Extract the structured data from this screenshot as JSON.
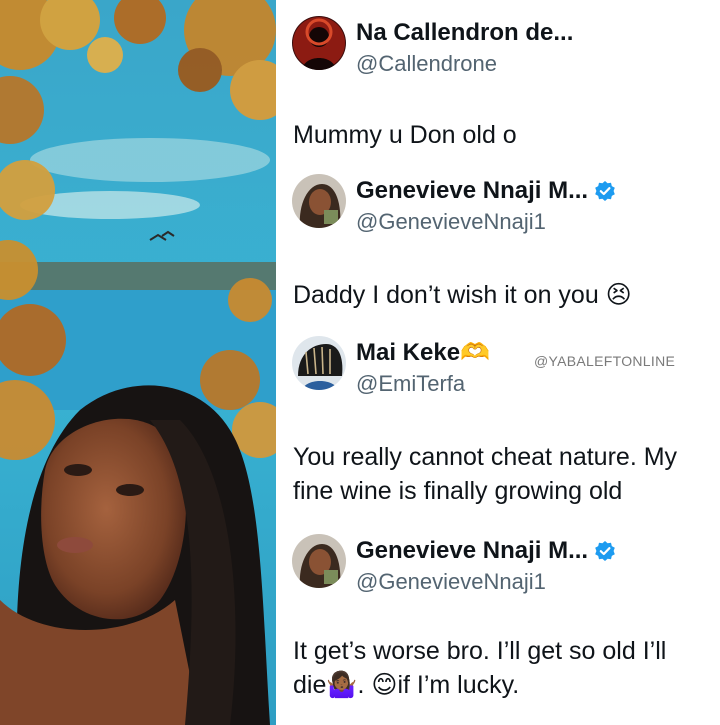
{
  "tweets": [
    {
      "display_name": "Na Callendron de...",
      "handle": "@Callendrone",
      "text": "Mummy u Don old o",
      "verified": false,
      "avatar_icon": "person-silhouette-red-avatar"
    },
    {
      "display_name": "Genevieve Nnaji M...",
      "handle": "@GenevieveNnaji1",
      "text": "Daddy I don’t wish it on you 😣",
      "verified": true,
      "avatar_icon": "woman-photo-avatar"
    },
    {
      "display_name": "Mai Keke🫶",
      "handle": "@EmiTerfa",
      "text": "You really cannot cheat nature. My fine wine is finally growing old",
      "verified": false,
      "avatar_icon": "braided-hair-avatar"
    },
    {
      "display_name": "Genevieve Nnaji M...",
      "handle": "@GenevieveNnaji1",
      "text": "It get’s worse bro. I’ll get so old I’ll die🤷🏾‍♀️. 😊if I’m lucky.",
      "verified": true,
      "avatar_icon": "woman-photo-avatar"
    }
  ],
  "watermark": "@YABALEFTONLINE",
  "colors": {
    "verified_blue": "#1d9bf0",
    "handle_gray": "#536471",
    "text": "#0f1419"
  }
}
